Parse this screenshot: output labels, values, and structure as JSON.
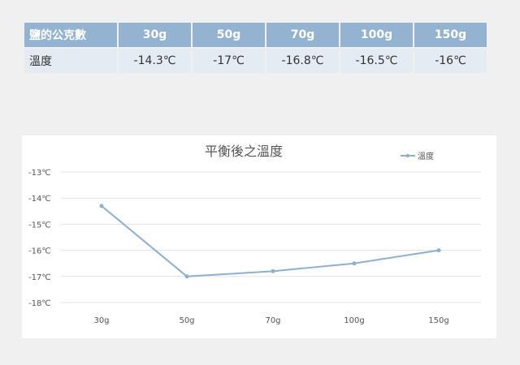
{
  "table": {
    "header_label": "鹽的公克數",
    "columns": [
      "30g",
      "50g",
      "70g",
      "100g",
      "150g"
    ],
    "row_label": "溫度",
    "values": [
      "-14.3℃",
      "-17℃",
      "-16.8℃",
      "-16.5℃",
      "-16℃"
    ]
  },
  "chart_data": {
    "type": "line",
    "title": "平衡後之溫度",
    "categories": [
      "30g",
      "50g",
      "70g",
      "100g",
      "150g"
    ],
    "series": [
      {
        "name": "溫度",
        "values": [
          -14.3,
          -17,
          -16.8,
          -16.5,
          -16
        ],
        "color": "#8fb0cc"
      }
    ],
    "ylim": [
      -18,
      -13
    ],
    "yticks": [
      -13,
      -14,
      -15,
      -16,
      -17,
      -18
    ],
    "ytick_labels": [
      "-13℃",
      "-14℃",
      "-15℃",
      "-16℃",
      "-17℃",
      "-18℃"
    ],
    "grid": true,
    "legend": "top-right"
  }
}
